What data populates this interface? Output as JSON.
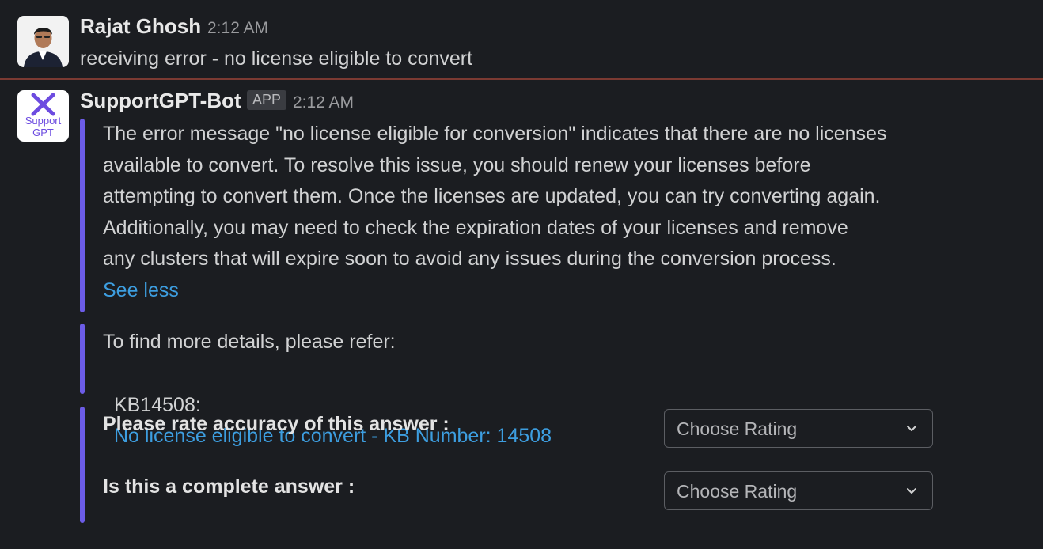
{
  "messages": [
    {
      "author": "Rajat Ghosh",
      "time": "2:12 AM",
      "text": "receiving error - no license eligible to convert"
    },
    {
      "author": "SupportGPT-Bot",
      "badge": "APP",
      "time": "2:12 AM",
      "logo_text_1": "Support",
      "logo_text_2": "GPT",
      "answer": "The error message \"no license eligible for conversion\" indicates that there are no licenses\navailable to convert. To resolve this issue, you should renew your licenses before\nattempting to convert them. Once the licenses are updated, you can try converting again.\nAdditionally, you may need to check the expiration dates of your licenses and remove\nany clusters that will expire soon to avoid any issues during the conversion process.",
      "see_less": "See less",
      "refer_text": "To find more details, please refer:",
      "kb_prefix": "KB14508:",
      "kb_link": "No license eligible to convert - KB Number: 14508",
      "rate_accuracy_label": "Please rate accuracy of this answer :",
      "complete_label": "Is this a complete answer :",
      "rating_placeholder": "Choose Rating"
    }
  ],
  "colors": {
    "background": "#1b1d21",
    "accent_bar": "#6c5ce7",
    "link": "#3d9ee0",
    "divider": "#7b3a32"
  }
}
